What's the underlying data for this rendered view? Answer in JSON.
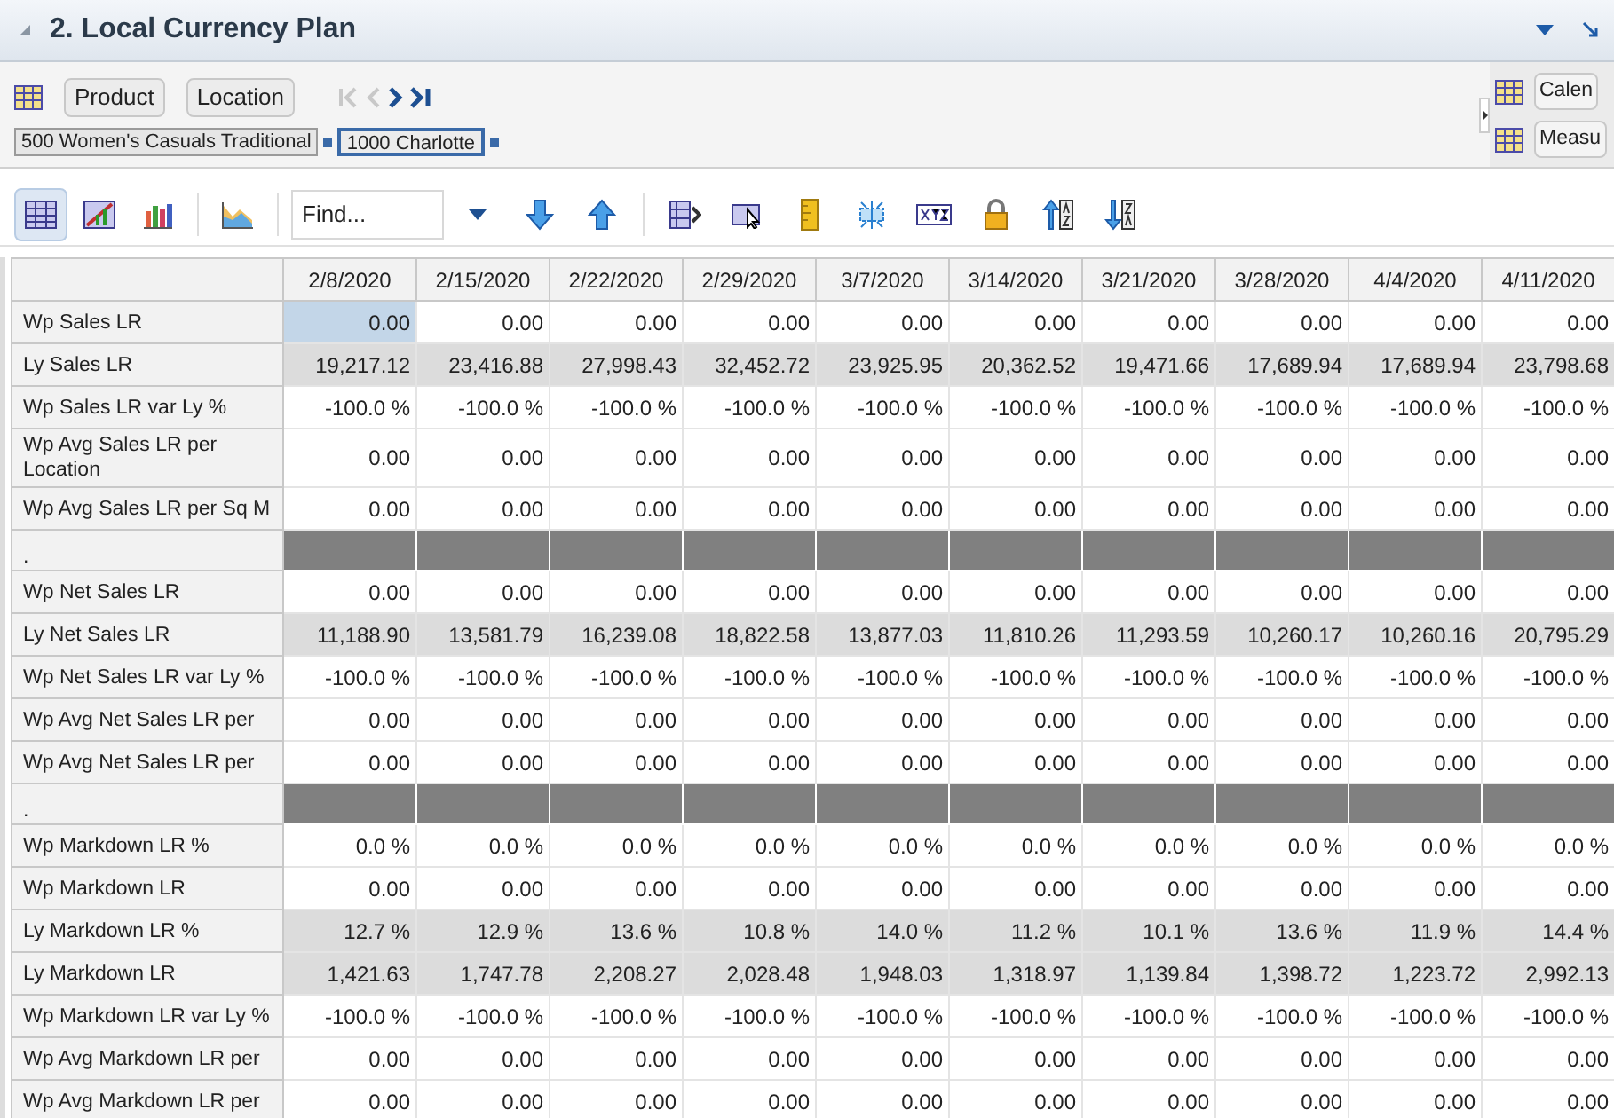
{
  "panel": {
    "title": "2. Local Currency Plan",
    "expanded": true
  },
  "pivot": {
    "tiles": [
      "Product",
      "Location"
    ],
    "path": [
      {
        "label": "500 Women's Casuals Traditional",
        "selected": false
      },
      {
        "label": "1000 Charlotte",
        "selected": true
      }
    ],
    "side_tiles": [
      "Calen",
      "Measu"
    ]
  },
  "toolbar": {
    "views": [
      {
        "selected": true
      },
      {
        "selected": false
      },
      {
        "selected": false
      },
      {
        "selected": false
      }
    ],
    "find": {
      "placeholder": "Find..."
    }
  },
  "grid": {
    "columns": [
      "2/8/2020",
      "2/15/2020",
      "2/22/2020",
      "2/29/2020",
      "3/7/2020",
      "3/14/2020",
      "3/21/2020",
      "3/28/2020",
      "4/4/2020",
      "4/11/2020"
    ],
    "rows": [
      {
        "label": "Wp Sales LR",
        "kind": "plan",
        "tall": false,
        "selected": true,
        "values": [
          "0.00",
          "0.00",
          "0.00",
          "0.00",
          "0.00",
          "0.00",
          "0.00",
          "0.00",
          "0.00",
          "0.00"
        ]
      },
      {
        "label": "Ly Sales LR",
        "kind": "last_year",
        "tall": false,
        "selected": false,
        "values": [
          "19,217.12",
          "23,416.88",
          "27,998.43",
          "32,452.72",
          "23,925.95",
          "20,362.52",
          "19,471.66",
          "17,689.94",
          "17,689.94",
          "23,798.68"
        ]
      },
      {
        "label": "Wp Sales LR var Ly %",
        "kind": "plan",
        "tall": false,
        "selected": false,
        "values": [
          "-100.0 %",
          "-100.0 %",
          "-100.0 %",
          "-100.0 %",
          "-100.0 %",
          "-100.0 %",
          "-100.0 %",
          "-100.0 %",
          "-100.0 %",
          "-100.0 %"
        ]
      },
      {
        "label": "Wp Avg Sales LR per Location",
        "kind": "plan",
        "tall": true,
        "selected": false,
        "values": [
          "0.00",
          "0.00",
          "0.00",
          "0.00",
          "0.00",
          "0.00",
          "0.00",
          "0.00",
          "0.00",
          "0.00"
        ]
      },
      {
        "label": "Wp Avg Sales LR per Sq M",
        "kind": "plan",
        "tall": false,
        "selected": false,
        "values": [
          "0.00",
          "0.00",
          "0.00",
          "0.00",
          "0.00",
          "0.00",
          "0.00",
          "0.00",
          "0.00",
          "0.00"
        ]
      },
      {
        "label": ".",
        "kind": "separator",
        "tall": false,
        "selected": false,
        "values": []
      },
      {
        "label": "Wp Net Sales LR",
        "kind": "plan",
        "tall": false,
        "selected": false,
        "values": [
          "0.00",
          "0.00",
          "0.00",
          "0.00",
          "0.00",
          "0.00",
          "0.00",
          "0.00",
          "0.00",
          "0.00"
        ]
      },
      {
        "label": "Ly Net Sales LR",
        "kind": "last_year",
        "tall": false,
        "selected": false,
        "values": [
          "11,188.90",
          "13,581.79",
          "16,239.08",
          "18,822.58",
          "13,877.03",
          "11,810.26",
          "11,293.59",
          "10,260.17",
          "10,260.16",
          "20,795.29"
        ]
      },
      {
        "label": "Wp Net Sales LR var Ly %",
        "kind": "plan",
        "tall": false,
        "selected": false,
        "values": [
          "-100.0 %",
          "-100.0 %",
          "-100.0 %",
          "-100.0 %",
          "-100.0 %",
          "-100.0 %",
          "-100.0 %",
          "-100.0 %",
          "-100.0 %",
          "-100.0 %"
        ]
      },
      {
        "label": "Wp Avg Net Sales LR per",
        "kind": "plan",
        "tall": false,
        "selected": false,
        "values": [
          "0.00",
          "0.00",
          "0.00",
          "0.00",
          "0.00",
          "0.00",
          "0.00",
          "0.00",
          "0.00",
          "0.00"
        ]
      },
      {
        "label": "Wp Avg Net Sales LR per",
        "kind": "plan",
        "tall": false,
        "selected": false,
        "values": [
          "0.00",
          "0.00",
          "0.00",
          "0.00",
          "0.00",
          "0.00",
          "0.00",
          "0.00",
          "0.00",
          "0.00"
        ]
      },
      {
        "label": ".",
        "kind": "separator",
        "tall": false,
        "selected": false,
        "values": []
      },
      {
        "label": "Wp Markdown LR %",
        "kind": "plan",
        "tall": false,
        "selected": false,
        "values": [
          "0.0 %",
          "0.0 %",
          "0.0 %",
          "0.0 %",
          "0.0 %",
          "0.0 %",
          "0.0 %",
          "0.0 %",
          "0.0 %",
          "0.0 %"
        ]
      },
      {
        "label": "Wp Markdown LR",
        "kind": "plan",
        "tall": false,
        "selected": false,
        "values": [
          "0.00",
          "0.00",
          "0.00",
          "0.00",
          "0.00",
          "0.00",
          "0.00",
          "0.00",
          "0.00",
          "0.00"
        ]
      },
      {
        "label": "Ly Markdown LR %",
        "kind": "last_year",
        "tall": false,
        "selected": false,
        "values": [
          "12.7 %",
          "12.9 %",
          "13.6 %",
          "10.8 %",
          "14.0 %",
          "11.2 %",
          "10.1 %",
          "13.6 %",
          "11.9 %",
          "14.4 %"
        ]
      },
      {
        "label": "Ly Markdown LR",
        "kind": "last_year",
        "tall": false,
        "selected": false,
        "values": [
          "1,421.63",
          "1,747.78",
          "2,208.27",
          "2,028.48",
          "1,948.03",
          "1,318.97",
          "1,139.84",
          "1,398.72",
          "1,223.72",
          "2,992.13"
        ]
      },
      {
        "label": "Wp Markdown LR var Ly %",
        "kind": "plan",
        "tall": false,
        "selected": false,
        "values": [
          "-100.0 %",
          "-100.0 %",
          "-100.0 %",
          "-100.0 %",
          "-100.0 %",
          "-100.0 %",
          "-100.0 %",
          "-100.0 %",
          "-100.0 %",
          "-100.0 %"
        ]
      },
      {
        "label": "Wp Avg Markdown LR per",
        "kind": "plan",
        "tall": false,
        "selected": false,
        "values": [
          "0.00",
          "0.00",
          "0.00",
          "0.00",
          "0.00",
          "0.00",
          "0.00",
          "0.00",
          "0.00",
          "0.00"
        ]
      },
      {
        "label": "Wp Avg Markdown LR per",
        "kind": "plan",
        "tall": false,
        "selected": false,
        "values": [
          "0.00",
          "0.00",
          "0.00",
          "0.00",
          "0.00",
          "0.00",
          "0.00",
          "0.00",
          "0.00",
          "0.00"
        ]
      }
    ]
  }
}
